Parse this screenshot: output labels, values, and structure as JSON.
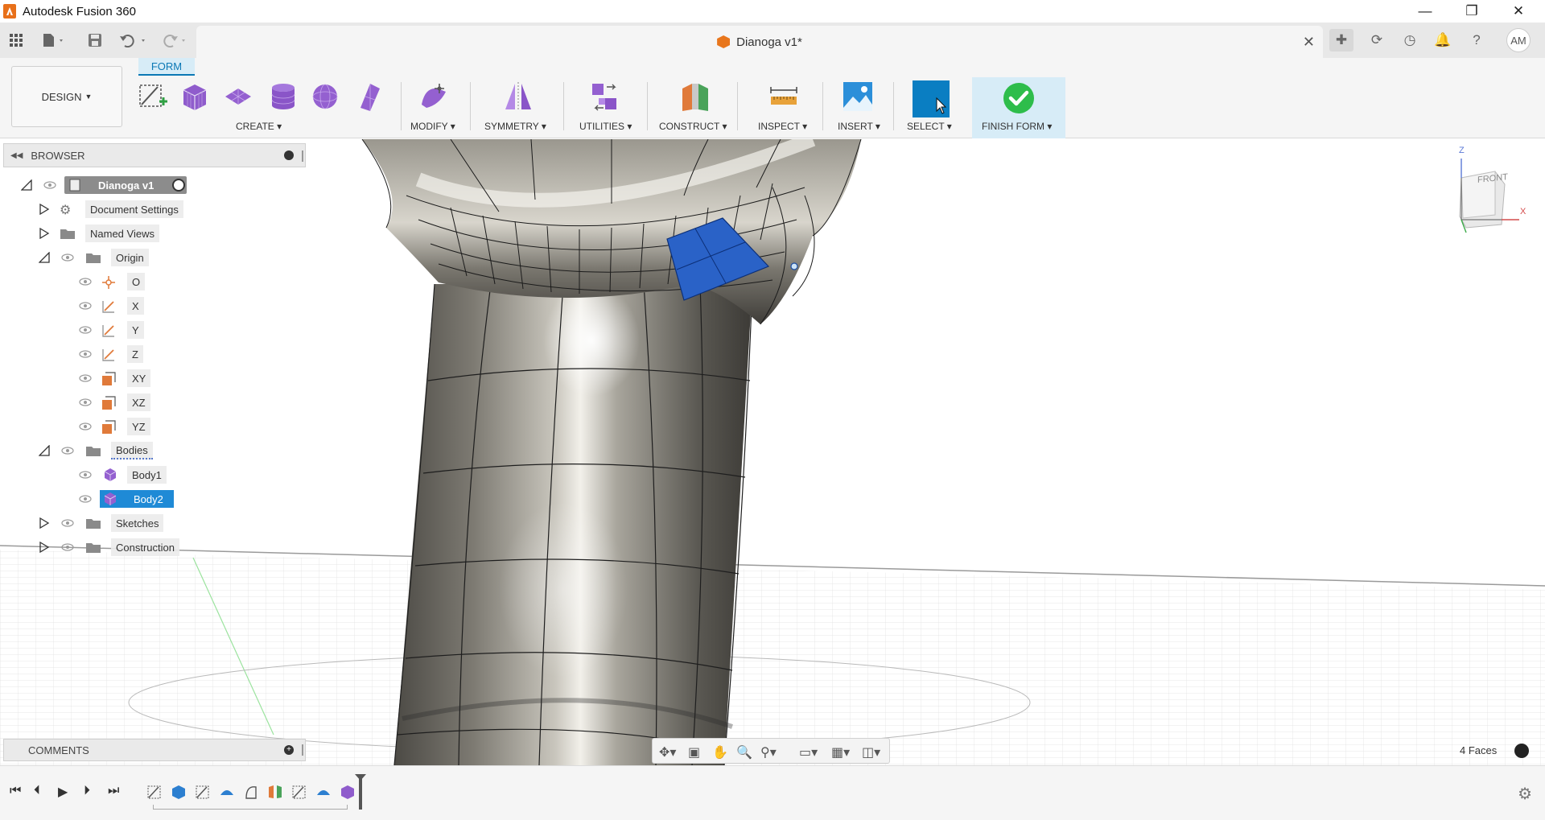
{
  "window": {
    "title": "Autodesk Fusion 360",
    "controls": [
      "minimize",
      "maximize",
      "close"
    ]
  },
  "tab": {
    "title": "Dianoga v1*",
    "close": "✕"
  },
  "user": {
    "initials": "AM"
  },
  "toolbar": {
    "workspace": "DESIGN",
    "active_tab": "FORM",
    "groups": [
      {
        "label": "CREATE"
      },
      {
        "label": "MODIFY"
      },
      {
        "label": "SYMMETRY"
      },
      {
        "label": "UTILITIES"
      },
      {
        "label": "CONSTRUCT"
      },
      {
        "label": "INSPECT"
      },
      {
        "label": "INSERT"
      },
      {
        "label": "SELECT"
      },
      {
        "label": "FINISH FORM"
      }
    ]
  },
  "browser": {
    "title": "BROWSER",
    "root": "Dianoga v1",
    "items": [
      {
        "label": "Document Settings"
      },
      {
        "label": "Named Views"
      },
      {
        "label": "Origin"
      },
      {
        "label": "O"
      },
      {
        "label": "X"
      },
      {
        "label": "Y"
      },
      {
        "label": "Z"
      },
      {
        "label": "XY"
      },
      {
        "label": "XZ"
      },
      {
        "label": "YZ"
      },
      {
        "label": "Bodies"
      },
      {
        "label": "Body1"
      },
      {
        "label": "Body2"
      },
      {
        "label": "Sketches"
      },
      {
        "label": "Construction"
      }
    ]
  },
  "viewcube": {
    "face": "FRONT",
    "axes": [
      "Z",
      "X"
    ]
  },
  "comments": {
    "title": "COMMENTS"
  },
  "status": {
    "selection": "4 Faces"
  },
  "colors": {
    "accent": "#0b78b5",
    "selected_face": "#2a62c7",
    "form_body": "#8a877f",
    "finish_check": "#2ebd4b",
    "origin_plane": "#e07a3a"
  }
}
